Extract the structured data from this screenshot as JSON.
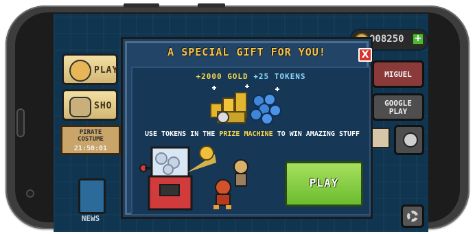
{
  "background_ui": {
    "gold_counter": "008250",
    "buttons_left": [
      {
        "label": "PLAY"
      },
      {
        "label": "SHO"
      }
    ],
    "event_card": {
      "title": "PIRATE\nCOSTUME",
      "timer": "21:50:01"
    },
    "news": {
      "label": "NEWS"
    },
    "buttons_right": [
      {
        "label": "MIGUEL"
      },
      {
        "label": "GOOGLE\nPLAY"
      }
    ]
  },
  "dialog": {
    "title": "A SPECIAL GIFT FOR YOU!",
    "close_label": "X",
    "reward_gold": "+2000 GOLD",
    "reward_tokens": "+25 TOKENS",
    "desc_part1": "USE TOKENS IN THE ",
    "desc_highlight": "PRIZE MACHINE",
    "desc_part2": " TO WIN AMAZING STUFF",
    "play_label": "PLAY"
  },
  "colors": {
    "accent_gold": "#f6d64c",
    "play_green": "#7ccc3b",
    "close_red": "#d8322c",
    "token_blue": "#8dd8ff"
  }
}
